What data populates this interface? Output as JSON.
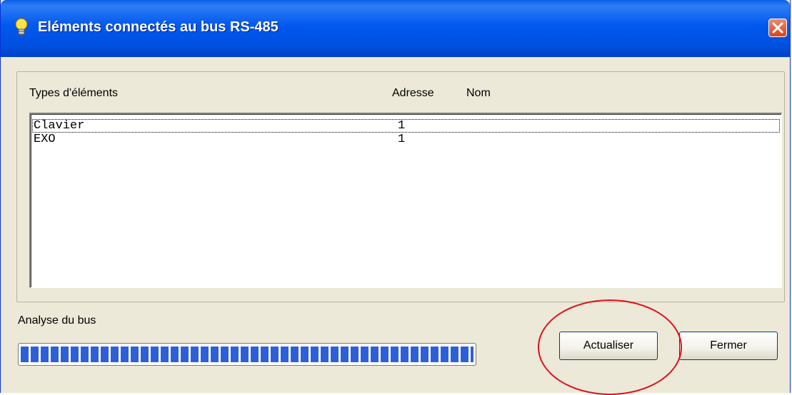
{
  "window": {
    "title": "Eléments connectés au bus RS-485",
    "icon": "lightbulb-icon",
    "close_icon": "close-icon"
  },
  "list": {
    "headers": {
      "type": "Types d'éléments",
      "address": "Adresse",
      "name": "Nom"
    },
    "rows": [
      {
        "type": "Clavier",
        "address": "1",
        "name": ""
      },
      {
        "type": "EXO",
        "address": "1",
        "name": ""
      }
    ]
  },
  "progress": {
    "label": "Analyse du bus",
    "value": 1.0
  },
  "buttons": {
    "refresh": "Actualiser",
    "close": "Fermer"
  },
  "colors": {
    "titlebar": "#0058ee",
    "progress_fill": "#2d5fd8",
    "annotation": "#e0101c"
  }
}
